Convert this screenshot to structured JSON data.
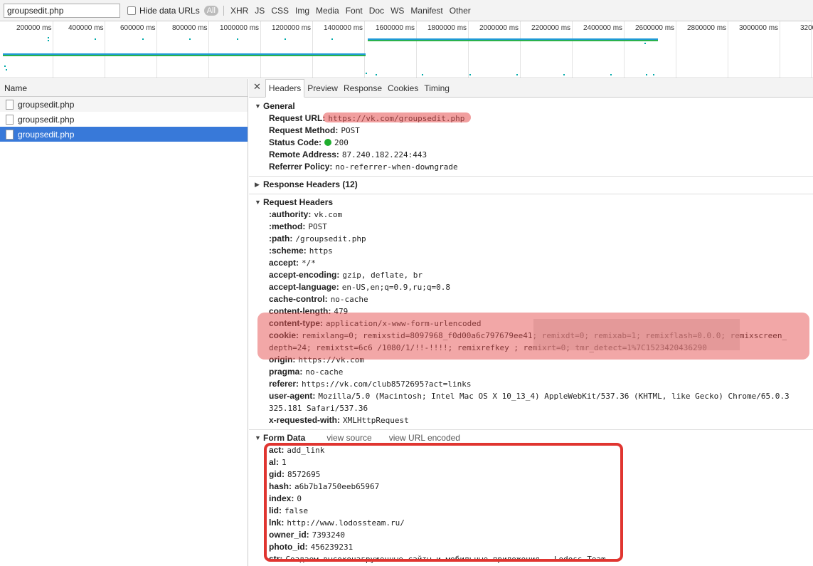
{
  "toolbar": {
    "filter_value": "groupsedit.php",
    "hide_data_urls": "Hide data URLs",
    "all": "All",
    "types": [
      "XHR",
      "JS",
      "CSS",
      "Img",
      "Media",
      "Font",
      "Doc",
      "WS",
      "Manifest",
      "Other"
    ]
  },
  "timeline": {
    "ticks": [
      "200000 ms",
      "400000 ms",
      "600000 ms",
      "800000 ms",
      "1000000 ms",
      "1200000 ms",
      "1400000 ms",
      "1600000 ms",
      "1800000 ms",
      "2000000 ms",
      "2200000 ms",
      "2400000 ms",
      "2600000 ms",
      "2800000 ms",
      "3000000 ms",
      "3200"
    ]
  },
  "requests": {
    "header": "Name",
    "items": [
      "groupsedit.php",
      "groupsedit.php",
      "groupsedit.php"
    ]
  },
  "tabs": [
    "Headers",
    "Preview",
    "Response",
    "Cookies",
    "Timing"
  ],
  "general": {
    "title": "General",
    "rows": [
      {
        "k": "Request URL:",
        "v": "https://vk.com/groupsedit.php"
      },
      {
        "k": "Request Method:",
        "v": "POST"
      },
      {
        "k": "Status Code:",
        "v": "200"
      },
      {
        "k": "Remote Address:",
        "v": "87.240.182.224:443"
      },
      {
        "k": "Referrer Policy:",
        "v": "no-referrer-when-downgrade"
      }
    ]
  },
  "response_headers": {
    "title": "Response Headers (12)"
  },
  "request_headers": {
    "title": "Request Headers",
    "rows": [
      {
        "k": ":authority:",
        "v": "vk.com"
      },
      {
        "k": ":method:",
        "v": "POST"
      },
      {
        "k": ":path:",
        "v": "/groupsedit.php"
      },
      {
        "k": ":scheme:",
        "v": "https"
      },
      {
        "k": "accept:",
        "v": "*/*"
      },
      {
        "k": "accept-encoding:",
        "v": "gzip, deflate, br"
      },
      {
        "k": "accept-language:",
        "v": "en-US,en;q=0.9,ru;q=0.8"
      },
      {
        "k": "cache-control:",
        "v": "no-cache"
      },
      {
        "k": "content-length:",
        "v": "479"
      },
      {
        "k": "content-type:",
        "v": "application/x-www-form-urlencoded"
      }
    ],
    "cookie_key": "cookie:",
    "cookie_value": "remixlang=0; remixstid=8097968_f0d00a6c797679ee41; remixdt=0; remixab=1; remixflash=0.0.0; remixscreen_depth=24; remixtst=6c6 /1080/1/!!-!!!!; remixrefkey ; remixrt=0; tmr_detect=1%7C1523420436290",
    "rows2": [
      {
        "k": "origin:",
        "v": "https://vk.com"
      },
      {
        "k": "pragma:",
        "v": "no-cache"
      },
      {
        "k": "referer:",
        "v": "https://vk.com/club8572695?act=links"
      },
      {
        "k": "user-agent:",
        "v": "Mozilla/5.0 (Macintosh; Intel Mac OS X 10_13_4) AppleWebKit/537.36 (KHTML, like Gecko) Chrome/65.0.3325.181 Safari/537.36"
      },
      {
        "k": "x-requested-with:",
        "v": "XMLHttpRequest"
      }
    ]
  },
  "form_data": {
    "title": "Form Data",
    "view_source": "view source",
    "view_url_encoded": "view URL encoded",
    "rows": [
      {
        "k": "act:",
        "v": "add_link"
      },
      {
        "k": "al:",
        "v": "1"
      },
      {
        "k": "gid:",
        "v": "8572695"
      },
      {
        "k": "hash:",
        "v": "a6b7b1a750eeb65967"
      },
      {
        "k": "index:",
        "v": "0"
      },
      {
        "k": "lid:",
        "v": "false"
      },
      {
        "k": "lnk:",
        "v": "http://www.lodossteam.ru/"
      },
      {
        "k": "owner_id:",
        "v": "7393240"
      },
      {
        "k": "photo_id:",
        "v": "456239231"
      },
      {
        "k": "str:",
        "v": "Создаем высоконагруженные сайты и мобильные приложения – Lodoss Team"
      }
    ]
  },
  "colors": {
    "selected_row": "#3879d9",
    "status_ok": "#1fae2f",
    "annotation_red": "#e03530"
  }
}
